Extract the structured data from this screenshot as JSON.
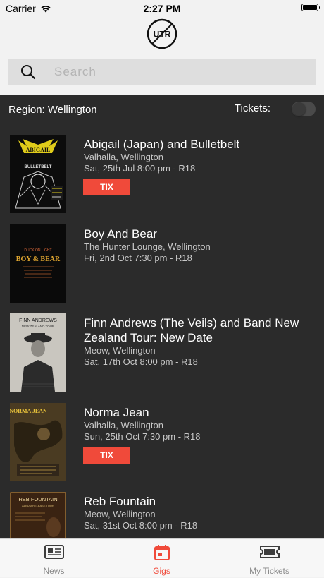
{
  "status": {
    "carrier": "Carrier",
    "time": "2:27 PM"
  },
  "header": {
    "logo_text": "UTR"
  },
  "search": {
    "placeholder": "Search",
    "value": ""
  },
  "filters": {
    "region": "Region: Wellington",
    "tickets_label": "Tickets:",
    "tickets_toggle_on": false
  },
  "gigs": [
    {
      "title": "Abigail (Japan) and Bulletbelt",
      "venue": "Valhalla, Wellington",
      "date": "Sat, 25th Jul 8:00 pm - R18",
      "tix_label": "TIX",
      "poster": {
        "line1": "ABIGAIL",
        "line2": "BULLETBELT"
      }
    },
    {
      "title": "Boy And Bear",
      "venue": "The Hunter Lounge, Wellington",
      "date": "Fri, 2nd Oct 7:30 pm - R18",
      "poster": {
        "line1": "DUCK ON LIGHT",
        "line2": "BOY & BEAR"
      }
    },
    {
      "title": "Finn Andrews (The Veils) and Band New Zealand Tour: New Date",
      "venue": "Meow, Wellington",
      "date": "Sat, 17th Oct 8:00 pm - R18",
      "poster": {
        "line1": "FINN ANDREWS",
        "line2": "NEW ZEALAND TOUR"
      }
    },
    {
      "title": "Norma Jean",
      "venue": "Valhalla, Wellington",
      "date": "Sun, 25th Oct 7:30 pm - R18",
      "tix_label": "TIX",
      "poster": {
        "line1": "NORMA JEAN"
      }
    },
    {
      "title": "Reb Fountain",
      "venue": "Meow, Wellington",
      "date": "Sat, 31st Oct 8:00 pm - R18",
      "poster": {
        "line1": "REB FOUNTAIN",
        "line2": "ALBUM RELEASE TOUR"
      }
    }
  ],
  "tabbar": {
    "news": "News",
    "gigs": "Gigs",
    "my_tickets": "My Tickets",
    "active": "gigs"
  },
  "colors": {
    "accent": "#f04a3a",
    "list_bg": "#2b2b2b"
  }
}
